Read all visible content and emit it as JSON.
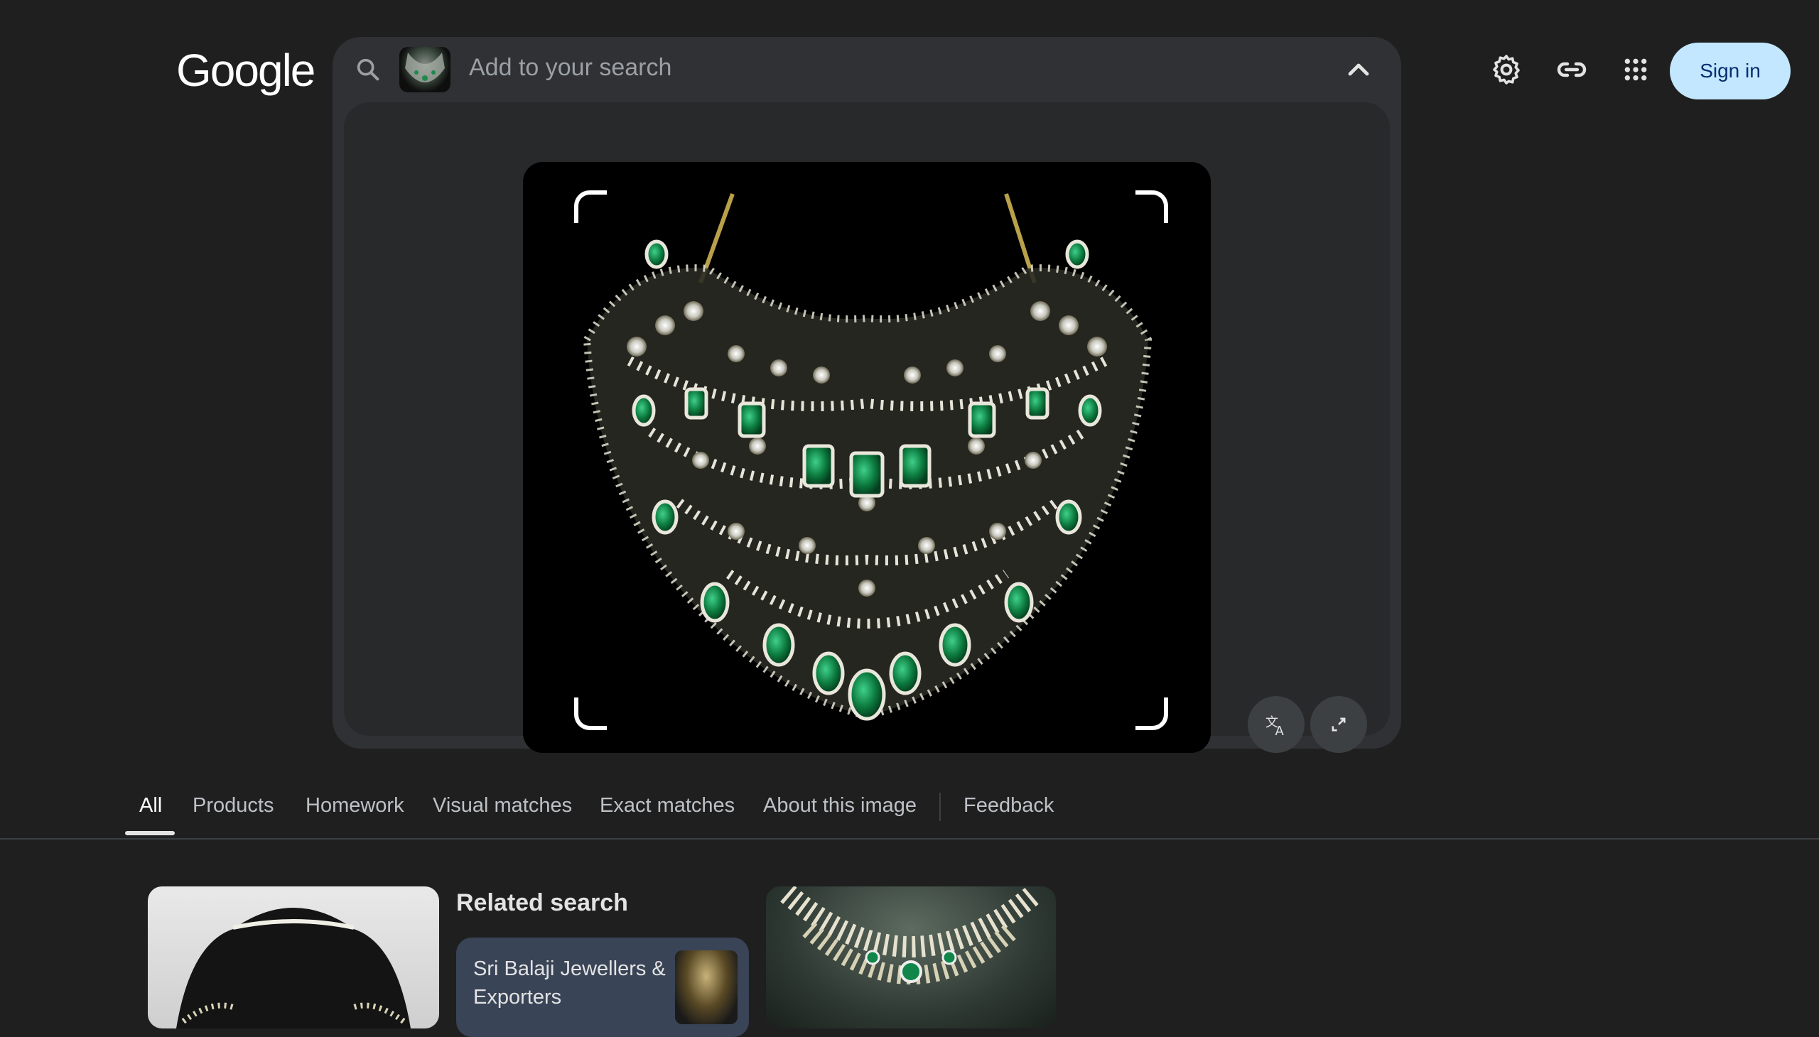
{
  "header": {
    "logo_text": "Google",
    "search_placeholder": "Add to your search",
    "signin_label": "Sign in",
    "icons": [
      "search-icon",
      "chevron-up-icon",
      "gear-icon",
      "link-icon",
      "apps-grid-icon"
    ]
  },
  "lens": {
    "actions": [
      "translate-icon",
      "expand-icon"
    ]
  },
  "tabs": [
    {
      "label": "All"
    },
    {
      "label": "Products"
    },
    {
      "label": "Homework"
    },
    {
      "label": "Visual matches"
    },
    {
      "label": "Exact matches"
    },
    {
      "label": "About this image"
    },
    {
      "label": "Feedback"
    }
  ],
  "results": {
    "related_title": "Related search",
    "related_chip_label": "Sri Balaji Jewellers & Exporters"
  },
  "colors": {
    "background": "#1f1f1f",
    "panel": "#303134",
    "signin_bg": "#c2e7ff",
    "emerald": "#0c7a3e"
  }
}
